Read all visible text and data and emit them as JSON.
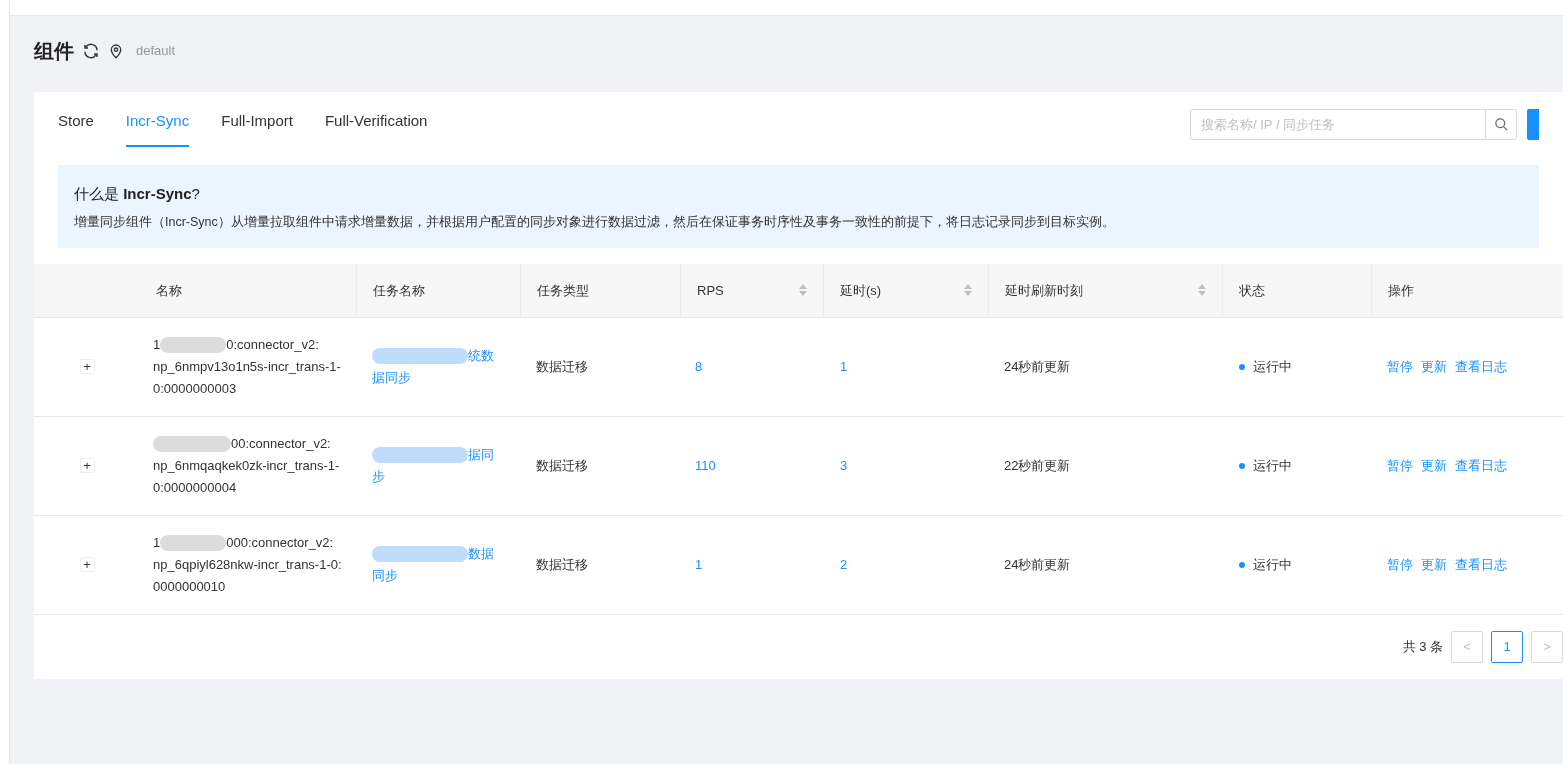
{
  "header": {
    "title": "组件",
    "namespace": "default"
  },
  "tabs": [
    {
      "label": "Store",
      "selected": false
    },
    {
      "label": "Incr-Sync",
      "selected": true
    },
    {
      "label": "Full-Import",
      "selected": false
    },
    {
      "label": "Full-Verification",
      "selected": false
    }
  ],
  "search": {
    "placeholder": "搜索名称/ IP / 同步任务"
  },
  "info": {
    "title": "什么是 **Incr-Sync**?",
    "text": "增量同步组件（Incr-Sync）从增量拉取组件中请求增量数据，并根据用户配置的同步对象进行数据过滤，然后在保证事务时序性及事务一致性的前提下，将日志记录同步到目标实例。"
  },
  "table": {
    "columns": [
      {
        "label": "名称",
        "sortable": false
      },
      {
        "label": "任务名称",
        "sortable": false
      },
      {
        "label": "任务类型",
        "sortable": false
      },
      {
        "label": "RPS",
        "sortable": true
      },
      {
        "label": "延时(s)",
        "sortable": true
      },
      {
        "label": "延时刷新时刻",
        "sortable": true
      },
      {
        "label": "状态",
        "sortable": false
      },
      {
        "label": "操作",
        "sortable": false
      }
    ],
    "rows": [
      {
        "expand": "+",
        "name_prefix": "1",
        "name_head": "0:connector_v2:",
        "name_tail": "np_6nmpv13o1n5s-incr_trans-1-0:0000000003",
        "task_head": "统数",
        "task_tail": "据同步",
        "type": "数据迁移",
        "rps": "8",
        "delay": "1",
        "refreshed": "24秒前更新",
        "status": "运行中",
        "actions": [
          "暂停",
          "更新",
          "查看日志"
        ]
      },
      {
        "expand": "+",
        "name_prefix": "",
        "name_head": "00:connector_v2:",
        "name_tail": "np_6nmqaqkek0zk-incr_trans-1-0:0000000004",
        "task_head": "据同",
        "task_tail": "步",
        "type": "数据迁移",
        "rps": "110",
        "delay": "3",
        "refreshed": "22秒前更新",
        "status": "运行中",
        "actions": [
          "暂停",
          "更新",
          "查看日志"
        ]
      },
      {
        "expand": "+",
        "name_prefix": "1",
        "name_head": "000:connector_v2:",
        "name_tail": "np_6qpiyl628nkw-incr_trans-1-0:0000000010",
        "task_head": "数据",
        "task_tail": "同步",
        "type": "数据迁移",
        "rps": "1",
        "delay": "2",
        "refreshed": "24秒前更新",
        "status": "运行中",
        "actions": [
          "暂停",
          "更新",
          "查看日志"
        ]
      }
    ]
  },
  "pagination": {
    "total": "共 3 条",
    "prev": "<",
    "pages": [
      {
        "label": "1",
        "selected": true
      }
    ],
    "next": ">"
  }
}
